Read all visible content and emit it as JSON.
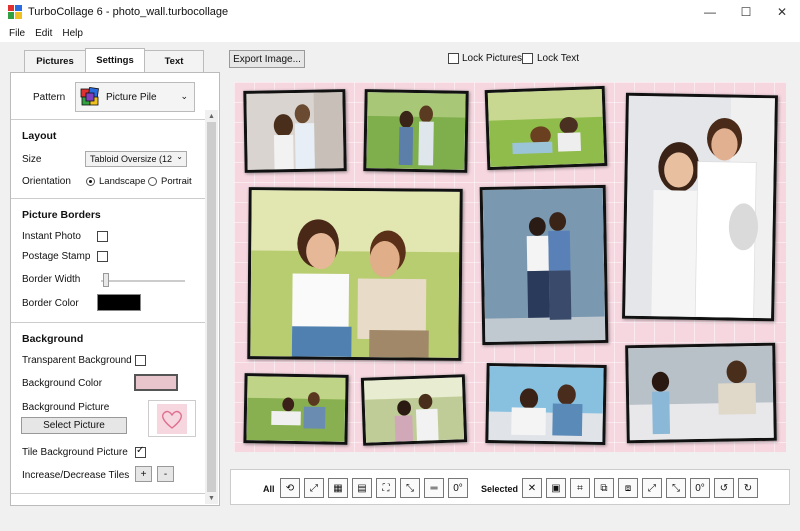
{
  "window": {
    "title": "TurboCollage 6 - photo_wall.turbocollage",
    "minimize": "—",
    "maximize": "☐",
    "close": "✕"
  },
  "menu": [
    "File",
    "Edit",
    "Help"
  ],
  "tabs": {
    "pictures": "Pictures",
    "settings": "Settings",
    "text": "Text"
  },
  "pattern": {
    "label": "Pattern",
    "value": "Picture Pile"
  },
  "layout": {
    "title": "Layout",
    "size_label": "Size",
    "size_value": "Tabloid Oversize (12",
    "orientation_label": "Orientation",
    "landscape": "Landscape",
    "portrait": "Portrait"
  },
  "borders": {
    "title": "Picture Borders",
    "instant_photo": "Instant Photo",
    "postage_stamp": "Postage Stamp",
    "border_width": "Border Width",
    "border_color": "Border Color",
    "border_color_value": "#000000"
  },
  "background": {
    "title": "Background",
    "transparent": "Transparent Background",
    "bg_color": "Background Color",
    "bg_color_value": "#e8c4cc",
    "bg_picture": "Background Picture",
    "select_picture": "Select Picture",
    "tile": "Tile Background Picture",
    "tiles": "Increase/Decrease Tiles",
    "plus": "+",
    "minus": "-"
  },
  "toolbar": {
    "export": "Export Image...",
    "lock_pictures": "Lock Pictures",
    "lock_text": "Lock Text"
  },
  "bottom": {
    "all": "All",
    "selected": "Selected"
  },
  "colors": {
    "canvas_bg": "#f6d7e0"
  }
}
